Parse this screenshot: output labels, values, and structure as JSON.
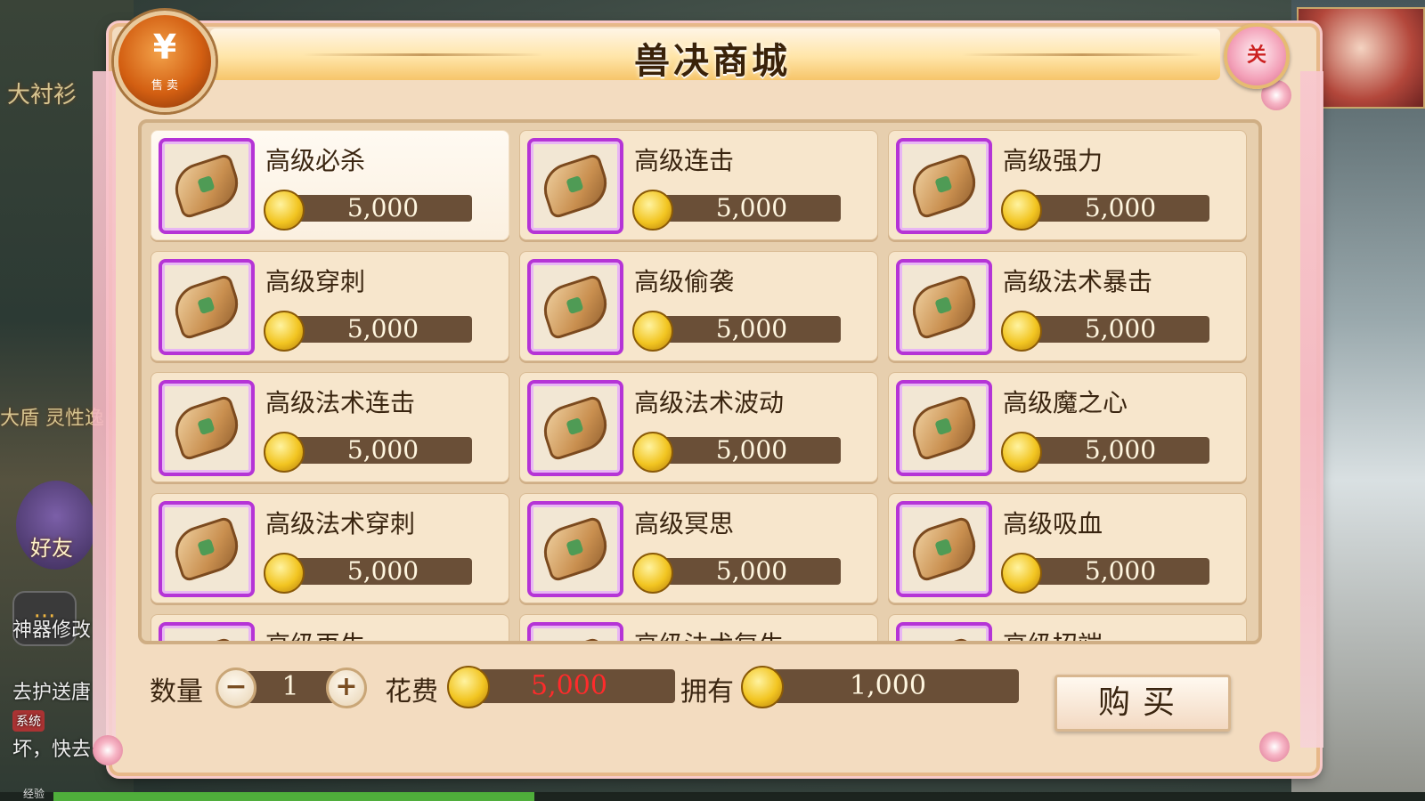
{
  "background": {
    "left_banner_1": "大衬衫",
    "left_banner_2": "大盾 灵性逸",
    "friend_label": "好友",
    "chat_lines": [
      "神器修改",
      "去护送唐",
      "系统",
      "坏，快去"
    ],
    "exp_label": "经验"
  },
  "shop": {
    "title": "兽决商城",
    "badge_symbol": "¥",
    "badge_text": "售 卖",
    "close_label": "关"
  },
  "items": [
    {
      "name": "高级必杀",
      "price": "5,000",
      "selected": true
    },
    {
      "name": "高级连击",
      "price": "5,000"
    },
    {
      "name": "高级强力",
      "price": "5,000"
    },
    {
      "name": "高级穿刺",
      "price": "5,000"
    },
    {
      "name": "高级偷袭",
      "price": "5,000"
    },
    {
      "name": "高级法术暴击",
      "price": "5,000"
    },
    {
      "name": "高级法术连击",
      "price": "5,000"
    },
    {
      "name": "高级法术波动",
      "price": "5,000"
    },
    {
      "name": "高级魔之心",
      "price": "5,000"
    },
    {
      "name": "高级法术穿刺",
      "price": "5,000"
    },
    {
      "name": "高级冥思",
      "price": "5,000"
    },
    {
      "name": "高级吸血",
      "price": "5,000"
    },
    {
      "name": "高级再生",
      "price": ""
    },
    {
      "name": "高级法术复生",
      "price": ""
    },
    {
      "name": "高级招端",
      "price": ""
    }
  ],
  "purchase": {
    "quantity_label": "数量",
    "quantity_value": "1",
    "minus": "−",
    "plus": "+",
    "cost_label": "花费",
    "cost_value": "5,000",
    "own_label": "拥有",
    "own_value": "1,000",
    "buy_label": "购买"
  },
  "colors": {
    "item_frame": "#b534d6",
    "cost_text": "#ff2b2b",
    "value_bar": "#6a4f37",
    "panel": "#f3dcc0"
  },
  "icons": {
    "item": "skill-scroll-icon",
    "currency": "gold-coin-icon"
  }
}
